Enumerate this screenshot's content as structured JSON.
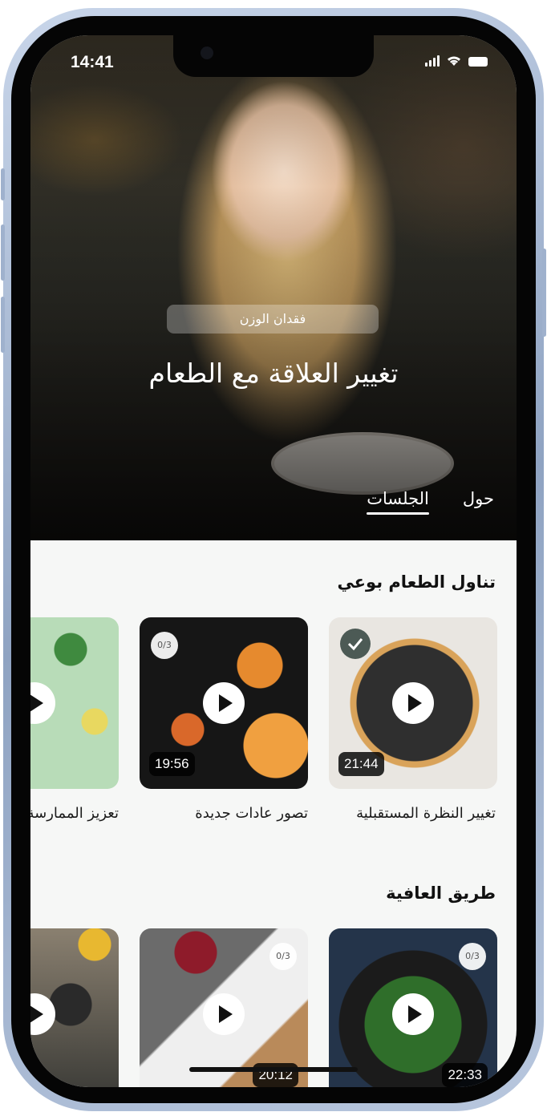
{
  "status_bar": {
    "time": "14:41"
  },
  "hero": {
    "category": "فقدان الوزن",
    "title": "تغيير العلاقة مع الطعام"
  },
  "tabs": [
    {
      "label": "الجلسات",
      "active": true
    },
    {
      "label": "حول",
      "active": false
    }
  ],
  "sections": [
    {
      "title": "تناول الطعام بوعي",
      "cards": [
        {
          "caption": "تغيير النظرة المستقبلية",
          "duration": "21:44",
          "completed": true
        },
        {
          "caption": "تصور عادات جديدة",
          "duration": "19:56",
          "progress": "0/3"
        },
        {
          "caption": "تعزيز الممارسة",
          "duration": "",
          "progress": ""
        }
      ]
    },
    {
      "title": "طريق العافية",
      "cards": [
        {
          "caption": "",
          "duration": "22:33",
          "progress": "0/3"
        },
        {
          "caption": "",
          "duration": "20:12",
          "progress": "0/3"
        },
        {
          "caption": "",
          "duration": "",
          "progress": ""
        }
      ]
    }
  ],
  "colors": {
    "background": "#f6f7f6",
    "text": "#111111",
    "check_badge": "#4c5a55"
  }
}
